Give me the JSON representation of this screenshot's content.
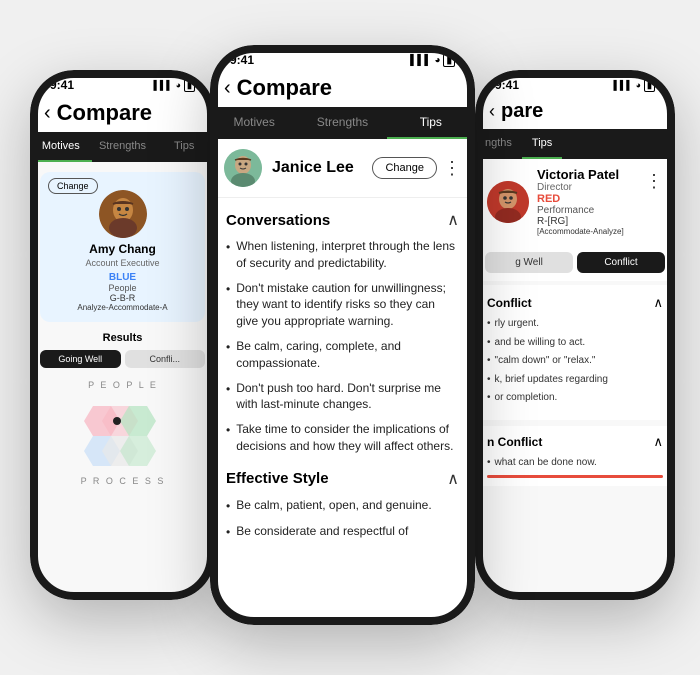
{
  "phones": {
    "left": {
      "time": "9:41",
      "nav_back": "‹",
      "nav_title": "Compare",
      "tabs": [
        "Motives",
        "Strengths",
        "Tips"
      ],
      "active_tab": "Motives",
      "contact": {
        "change_label": "Change",
        "name": "Amy Chang",
        "role": "Account Executive",
        "color_label": "BLUE",
        "color_sub": "People",
        "code": "G-B-R",
        "analyze": "Analyze-Accommodate-A"
      },
      "results_title": "Results",
      "results_tabs": [
        "Going Well",
        "Confli"
      ],
      "active_results": "Going Well"
    },
    "center": {
      "time": "9:41",
      "nav_back": "‹",
      "nav_title": "Compare",
      "tabs": [
        "Motives",
        "Strengths",
        "Tips"
      ],
      "active_tab": "Tips",
      "person": {
        "name": "Janice Lee",
        "change_label": "Change",
        "dots": "⋮"
      },
      "sections": [
        {
          "title": "Conversations",
          "expanded": true,
          "items": [
            "When listening, interpret through the lens of security and predictability.",
            "Don't mistake caution for unwillingness; they want to identify risks so they can give you appropriate warning.",
            "Be calm, caring, complete, and compassionate.",
            "Don't push too hard. Don't surprise me with last-minute changes.",
            "Take time to consider the implications of decisions and how they will affect others."
          ]
        },
        {
          "title": "Effective Style",
          "expanded": true,
          "items": [
            "Be calm, patient, open, and genuine.",
            "Be considerate and respectful of"
          ]
        }
      ]
    },
    "right": {
      "time": "9:41",
      "signal": "▌▌▌",
      "wifi": "wifi",
      "battery": "battery",
      "nav_back": "‹",
      "nav_title": "pare",
      "tabs_partial": [
        "ngths",
        "Tips"
      ],
      "active_tab": "Tips",
      "person": {
        "name": "Victoria Patel",
        "role": "Director",
        "color_label": "RED",
        "color_sub": "Performance",
        "code": "R-[RG]",
        "analyze": "[Accommodate-Analyze]",
        "dots": "⋮"
      },
      "results_tabs": [
        "g Well",
        "Conflict"
      ],
      "active_results": "Conflict",
      "conflict_section": {
        "title": "Conflict",
        "items": [
          "rly urgent.",
          "and be willing to act.",
          "\"calm down\" or \"relax.\"",
          "k, brief updates regarding",
          "or completion."
        ]
      },
      "under_conflict": {
        "title": "n Conflict",
        "items": [
          "what can be done now."
        ]
      }
    }
  }
}
